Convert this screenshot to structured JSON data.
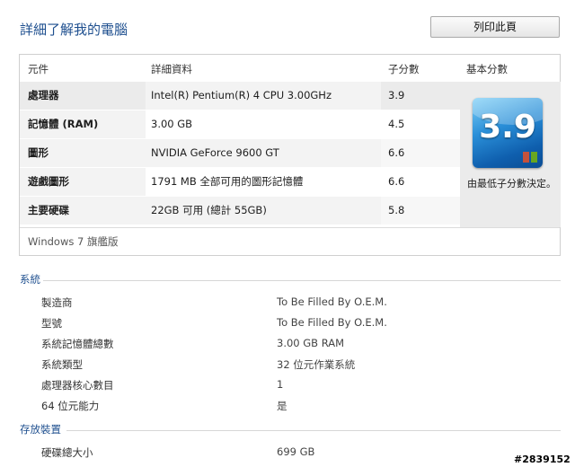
{
  "page": {
    "title": "詳細了解我的電腦",
    "print_button": "列印此頁"
  },
  "rating_table": {
    "headers": {
      "component": "元件",
      "details": "詳細資料",
      "subscore": "子分數",
      "base_score": "基本分數"
    },
    "rows": [
      {
        "component": "處理器",
        "details": "Intel(R) Pentium(R) 4 CPU 3.00GHz",
        "subscore": "3.9"
      },
      {
        "component": "記憶體 (RAM)",
        "details": "3.00 GB",
        "subscore": "4.5"
      },
      {
        "component": "圖形",
        "details": "NVIDIA GeForce 9600 GT",
        "subscore": "6.6"
      },
      {
        "component": "遊戲圖形",
        "details": "1791 MB 全部可用的圖形記憶體",
        "subscore": "6.6"
      },
      {
        "component": "主要硬碟",
        "details": "22GB 可用 (總計 55GB)",
        "subscore": "5.8"
      }
    ],
    "base_score": {
      "value": "3.9",
      "caption": "由最低子分數決定。"
    },
    "edition": "Windows 7 旗艦版"
  },
  "system": {
    "heading": "系統",
    "items": [
      {
        "key": "製造商",
        "value": "To Be Filled By O.E.M."
      },
      {
        "key": "型號",
        "value": "To Be Filled By O.E.M."
      },
      {
        "key": "系統記憶體總數",
        "value": "3.00 GB RAM"
      },
      {
        "key": "系統類型",
        "value": "32 位元作業系統"
      },
      {
        "key": "處理器核心數目",
        "value": "1"
      },
      {
        "key": "64 位元能力",
        "value": "是"
      }
    ]
  },
  "storage": {
    "heading": "存放裝置",
    "items": [
      {
        "key": "硬碟總大小",
        "value": "699 GB"
      }
    ]
  },
  "watermark": "#2839152"
}
